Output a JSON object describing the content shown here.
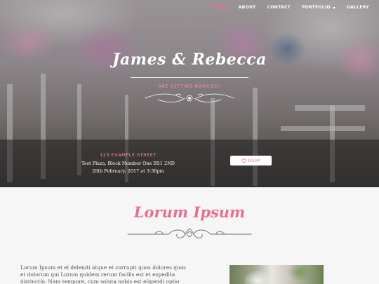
{
  "nav": {
    "items": [
      {
        "label": "HOME",
        "active": true
      },
      {
        "label": "ABOUT",
        "active": false
      },
      {
        "label": "CONTACT",
        "active": false
      },
      {
        "label": "PORTFOLIO",
        "active": false,
        "has_dropdown": true
      },
      {
        "label": "GALLERY",
        "active": false
      }
    ]
  },
  "hero": {
    "title": "James & Rebecca",
    "subtitle": "ARE GETTING MARRIED!"
  },
  "event": {
    "street": "123 EXAMPLE STREET",
    "address": "Test Plaza, Block Number One BS1 2ND",
    "date": "28th February, 2017 at 3:30pm",
    "rsvp_label": "RSVP",
    "rsvp_icon": "heart-icon"
  },
  "section": {
    "title": "Lorum Ipsum",
    "body_line_1": "Lorum Ipsum et el deleniti atque et corrupti quos dolores quas",
    "body_line_2": "et dolorum qui Lorum quidem rerum facilis est et expedita",
    "body_line_3": "distinctio. Nam tempore, cum soluta nobis est eligendi optio"
  },
  "colors": {
    "accent": "#e8708f",
    "band": "#231e20",
    "background": "#f6f6f6"
  }
}
